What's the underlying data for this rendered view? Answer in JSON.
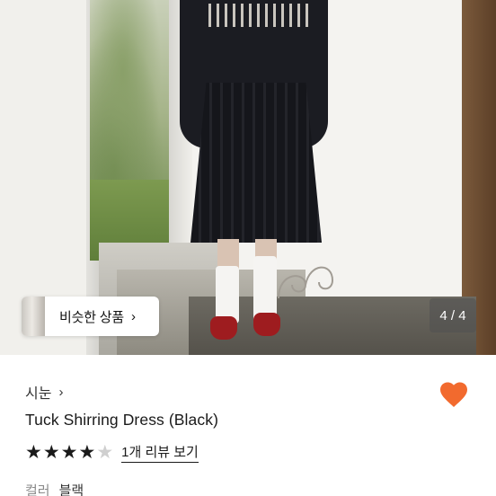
{
  "gallery": {
    "similar_label": "비슷한 상품",
    "similar_chevron": "›",
    "counter": "4 / 4"
  },
  "shop": {
    "name": "시눈",
    "chevron": "›"
  },
  "product": {
    "title": "Tuck Shirring Dress (Black)",
    "favorite_color": "#f26a2e"
  },
  "rating": {
    "score": 4,
    "max": 5,
    "stars": [
      "★",
      "★",
      "★",
      "★",
      "★"
    ],
    "review_link": "1개 리뷰 보기"
  },
  "options": {
    "color_label": "컬러",
    "color_value": "블랙"
  }
}
